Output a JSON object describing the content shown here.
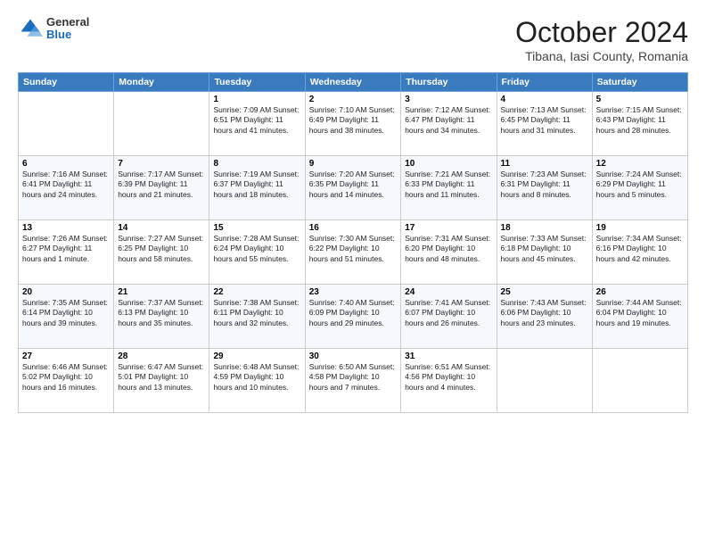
{
  "header": {
    "logo": {
      "general": "General",
      "blue": "Blue"
    },
    "title": "October 2024",
    "location": "Tibana, Iasi County, Romania"
  },
  "weekdays": [
    "Sunday",
    "Monday",
    "Tuesday",
    "Wednesday",
    "Thursday",
    "Friday",
    "Saturday"
  ],
  "weeks": [
    [
      {
        "day": "",
        "info": ""
      },
      {
        "day": "",
        "info": ""
      },
      {
        "day": "1",
        "info": "Sunrise: 7:09 AM\nSunset: 6:51 PM\nDaylight: 11 hours and 41 minutes."
      },
      {
        "day": "2",
        "info": "Sunrise: 7:10 AM\nSunset: 6:49 PM\nDaylight: 11 hours and 38 minutes."
      },
      {
        "day": "3",
        "info": "Sunrise: 7:12 AM\nSunset: 6:47 PM\nDaylight: 11 hours and 34 minutes."
      },
      {
        "day": "4",
        "info": "Sunrise: 7:13 AM\nSunset: 6:45 PM\nDaylight: 11 hours and 31 minutes."
      },
      {
        "day": "5",
        "info": "Sunrise: 7:15 AM\nSunset: 6:43 PM\nDaylight: 11 hours and 28 minutes."
      }
    ],
    [
      {
        "day": "6",
        "info": "Sunrise: 7:16 AM\nSunset: 6:41 PM\nDaylight: 11 hours and 24 minutes."
      },
      {
        "day": "7",
        "info": "Sunrise: 7:17 AM\nSunset: 6:39 PM\nDaylight: 11 hours and 21 minutes."
      },
      {
        "day": "8",
        "info": "Sunrise: 7:19 AM\nSunset: 6:37 PM\nDaylight: 11 hours and 18 minutes."
      },
      {
        "day": "9",
        "info": "Sunrise: 7:20 AM\nSunset: 6:35 PM\nDaylight: 11 hours and 14 minutes."
      },
      {
        "day": "10",
        "info": "Sunrise: 7:21 AM\nSunset: 6:33 PM\nDaylight: 11 hours and 11 minutes."
      },
      {
        "day": "11",
        "info": "Sunrise: 7:23 AM\nSunset: 6:31 PM\nDaylight: 11 hours and 8 minutes."
      },
      {
        "day": "12",
        "info": "Sunrise: 7:24 AM\nSunset: 6:29 PM\nDaylight: 11 hours and 5 minutes."
      }
    ],
    [
      {
        "day": "13",
        "info": "Sunrise: 7:26 AM\nSunset: 6:27 PM\nDaylight: 11 hours and 1 minute."
      },
      {
        "day": "14",
        "info": "Sunrise: 7:27 AM\nSunset: 6:25 PM\nDaylight: 10 hours and 58 minutes."
      },
      {
        "day": "15",
        "info": "Sunrise: 7:28 AM\nSunset: 6:24 PM\nDaylight: 10 hours and 55 minutes."
      },
      {
        "day": "16",
        "info": "Sunrise: 7:30 AM\nSunset: 6:22 PM\nDaylight: 10 hours and 51 minutes."
      },
      {
        "day": "17",
        "info": "Sunrise: 7:31 AM\nSunset: 6:20 PM\nDaylight: 10 hours and 48 minutes."
      },
      {
        "day": "18",
        "info": "Sunrise: 7:33 AM\nSunset: 6:18 PM\nDaylight: 10 hours and 45 minutes."
      },
      {
        "day": "19",
        "info": "Sunrise: 7:34 AM\nSunset: 6:16 PM\nDaylight: 10 hours and 42 minutes."
      }
    ],
    [
      {
        "day": "20",
        "info": "Sunrise: 7:35 AM\nSunset: 6:14 PM\nDaylight: 10 hours and 39 minutes."
      },
      {
        "day": "21",
        "info": "Sunrise: 7:37 AM\nSunset: 6:13 PM\nDaylight: 10 hours and 35 minutes."
      },
      {
        "day": "22",
        "info": "Sunrise: 7:38 AM\nSunset: 6:11 PM\nDaylight: 10 hours and 32 minutes."
      },
      {
        "day": "23",
        "info": "Sunrise: 7:40 AM\nSunset: 6:09 PM\nDaylight: 10 hours and 29 minutes."
      },
      {
        "day": "24",
        "info": "Sunrise: 7:41 AM\nSunset: 6:07 PM\nDaylight: 10 hours and 26 minutes."
      },
      {
        "day": "25",
        "info": "Sunrise: 7:43 AM\nSunset: 6:06 PM\nDaylight: 10 hours and 23 minutes."
      },
      {
        "day": "26",
        "info": "Sunrise: 7:44 AM\nSunset: 6:04 PM\nDaylight: 10 hours and 19 minutes."
      }
    ],
    [
      {
        "day": "27",
        "info": "Sunrise: 6:46 AM\nSunset: 5:02 PM\nDaylight: 10 hours and 16 minutes."
      },
      {
        "day": "28",
        "info": "Sunrise: 6:47 AM\nSunset: 5:01 PM\nDaylight: 10 hours and 13 minutes."
      },
      {
        "day": "29",
        "info": "Sunrise: 6:48 AM\nSunset: 4:59 PM\nDaylight: 10 hours and 10 minutes."
      },
      {
        "day": "30",
        "info": "Sunrise: 6:50 AM\nSunset: 4:58 PM\nDaylight: 10 hours and 7 minutes."
      },
      {
        "day": "31",
        "info": "Sunrise: 6:51 AM\nSunset: 4:56 PM\nDaylight: 10 hours and 4 minutes."
      },
      {
        "day": "",
        "info": ""
      },
      {
        "day": "",
        "info": ""
      }
    ]
  ]
}
